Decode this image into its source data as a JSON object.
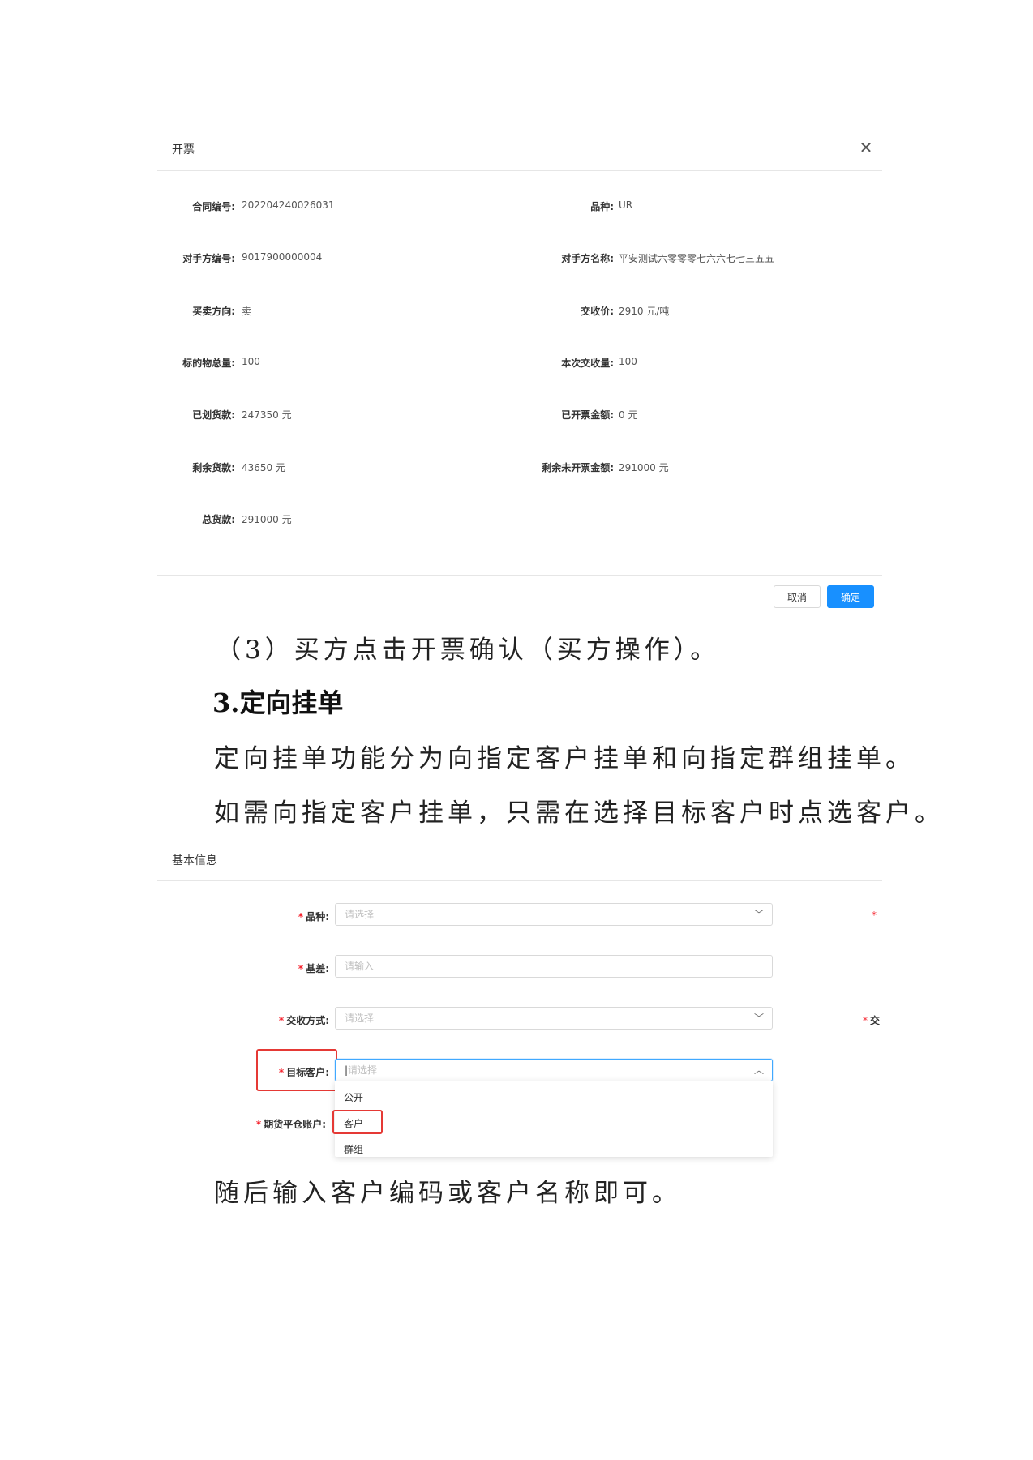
{
  "dialog": {
    "title": "开票",
    "close_icon": "close-icon",
    "fields_left": [
      {
        "label": "合同编号:",
        "value": "202204240026031"
      },
      {
        "label": "对手方编号:",
        "value": "9017900000004"
      },
      {
        "label": "买卖方向:",
        "value": "卖"
      },
      {
        "label": "标的物总量:",
        "value": "100"
      },
      {
        "label": "已划货款:",
        "value": "247350 元"
      },
      {
        "label": "剩余货款:",
        "value": "43650 元"
      },
      {
        "label": "总货款:",
        "value": "291000 元"
      }
    ],
    "fields_right": [
      {
        "label": "品种:",
        "value": "UR"
      },
      {
        "label": "对手方名称:",
        "value": "平安测试六零零零七六六七七三五五"
      },
      {
        "label": "交收价:",
        "value": "2910 元/吨"
      },
      {
        "label": "本次交收量:",
        "value": "100"
      },
      {
        "label": "已开票金额:",
        "value": "0 元"
      },
      {
        "label": "剩余未开票金额:",
        "value": "291000 元"
      }
    ],
    "cancel_label": "取消",
    "ok_label": "确定"
  },
  "doc": {
    "step3": "（3）买方点击开票确认（买方操作）。",
    "heading": "3.定向挂单",
    "para1": "定向挂单功能分为向指定客户挂单和向指定群组挂单。",
    "para2": "如需向指定客户挂单，只需在选择目标客户时点选客户。",
    "para3": "随后输入客户编码或客户名称即可。"
  },
  "form": {
    "section_title": "基本信息",
    "required_mark": "*",
    "fields": [
      {
        "label": "品种:",
        "placeholder": "请选择"
      },
      {
        "label": "基差:",
        "placeholder": "请输入"
      },
      {
        "label": "交收方式:",
        "placeholder": "请选择"
      },
      {
        "label": "目标客户:",
        "placeholder": "请选择"
      },
      {
        "label": "期货平仓账户:"
      }
    ],
    "right_partial_label": "交",
    "dropdown_options": [
      "公开",
      "客户",
      "群组"
    ],
    "highlight_color": "#e53935"
  }
}
